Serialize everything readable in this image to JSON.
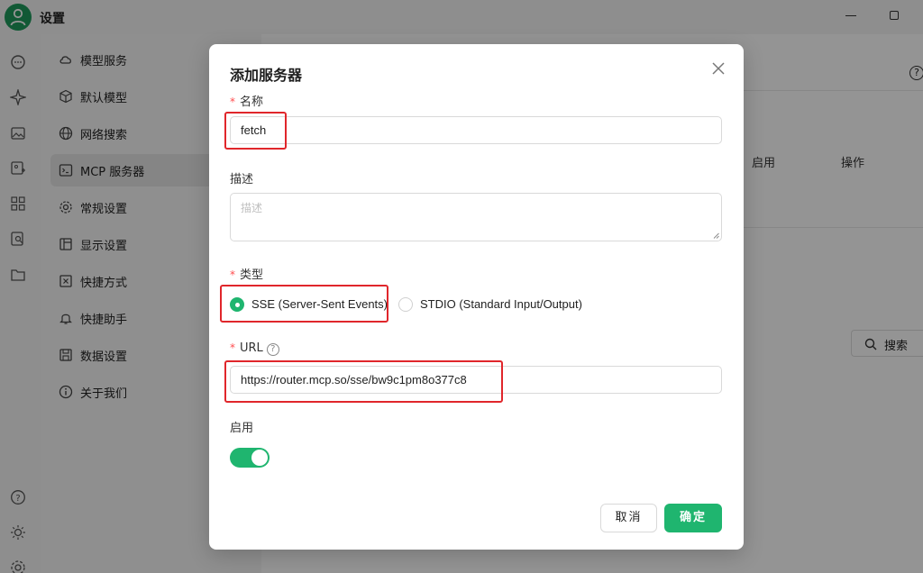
{
  "window": {
    "title": "设置"
  },
  "sidebar": {
    "items": [
      {
        "label": "模型服务",
        "icon": "cloud-icon"
      },
      {
        "label": "默认模型",
        "icon": "cube-icon"
      },
      {
        "label": "网络搜索",
        "icon": "globe-icon"
      },
      {
        "label": "MCP 服务器",
        "icon": "terminal-icon",
        "active": true
      },
      {
        "label": "常规设置",
        "icon": "gear-icon"
      },
      {
        "label": "显示设置",
        "icon": "layout-icon"
      },
      {
        "label": "快捷方式",
        "icon": "command-icon"
      },
      {
        "label": "快捷助手",
        "icon": "bell-icon"
      },
      {
        "label": "数据设置",
        "icon": "save-icon"
      },
      {
        "label": "关于我们",
        "icon": "info-icon"
      }
    ]
  },
  "background": {
    "table_headers": {
      "enable": "启用",
      "actions": "操作"
    },
    "search_label": "搜索"
  },
  "dialog": {
    "title": "添加服务器",
    "name": {
      "label": "名称",
      "value": "fetch"
    },
    "description": {
      "label": "描述",
      "placeholder": "描述"
    },
    "type": {
      "label": "类型",
      "options": [
        "SSE (Server-Sent Events)",
        "STDIO (Standard Input/Output)"
      ],
      "selected": "SSE (Server-Sent Events)"
    },
    "url": {
      "label": "URL",
      "value": "https://router.mcp.so/sse/bw9c1pm8o377c8"
    },
    "enable": {
      "label": "启用",
      "on": true
    },
    "cancel_label": "取消",
    "ok_label": "确定"
  },
  "colors": {
    "accent": "#1fb56f",
    "highlight": "#e0262b"
  }
}
